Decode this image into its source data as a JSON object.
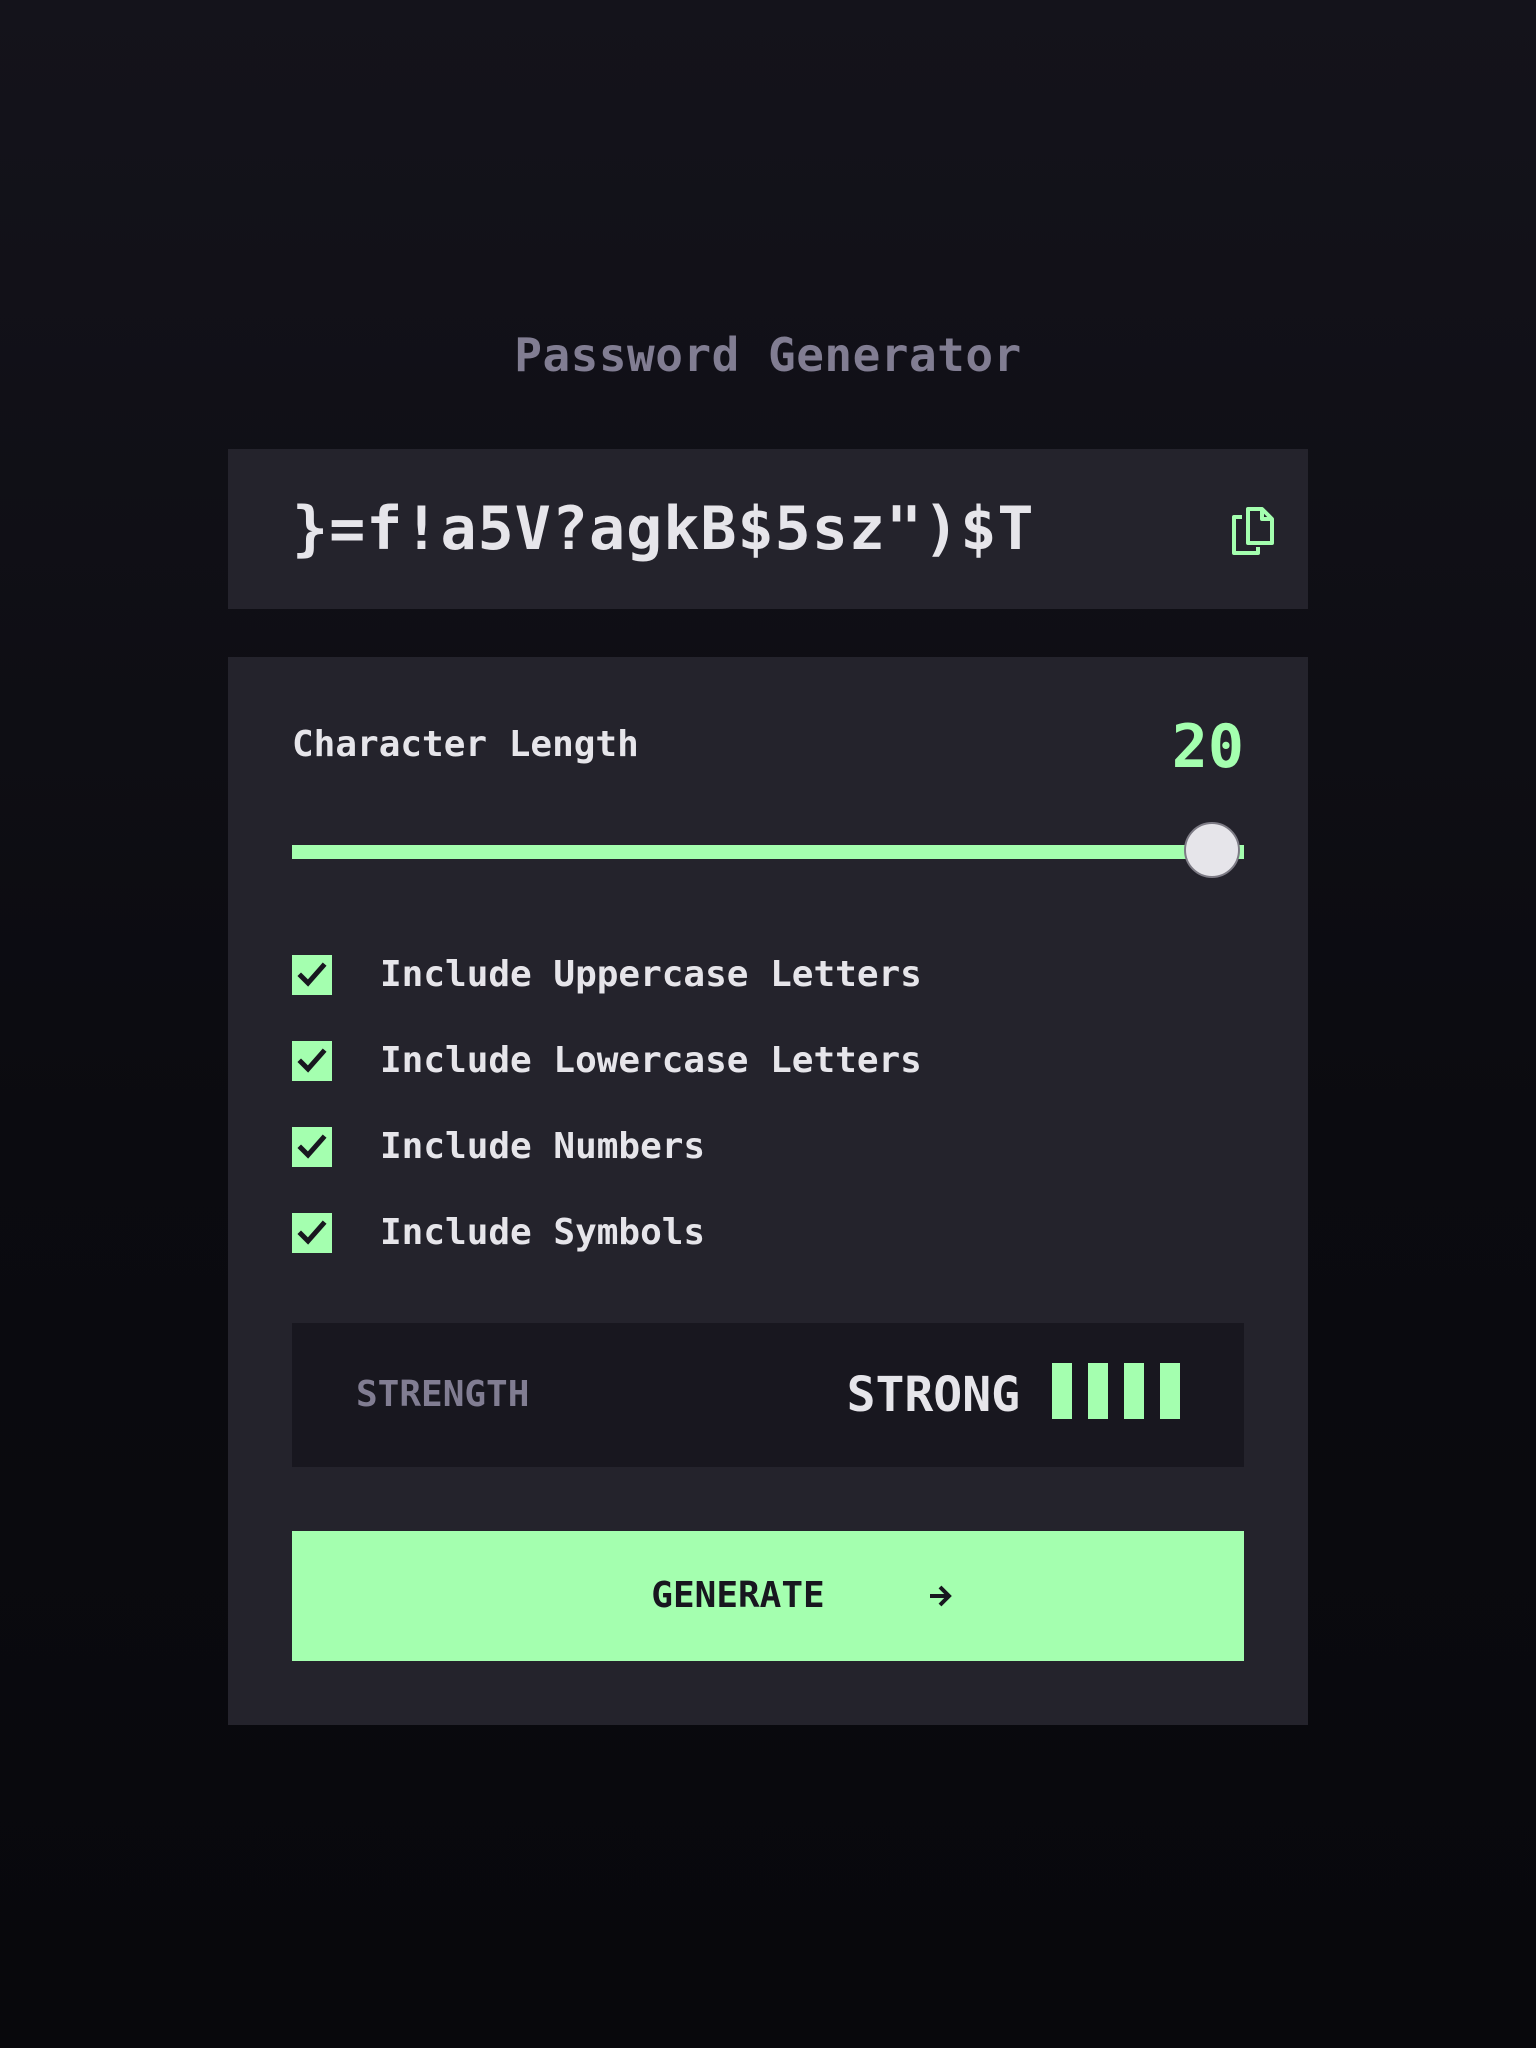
{
  "header": {
    "title": "Password Generator"
  },
  "output": {
    "password": "}=f!a5V?agkB$5sz\")$T",
    "copy_icon": "copy-icon"
  },
  "length": {
    "label": "Character Length",
    "value": "20",
    "slider_fraction": 1.0
  },
  "options": [
    {
      "label": "Include Uppercase Letters",
      "checked": true
    },
    {
      "label": "Include Lowercase Letters",
      "checked": true
    },
    {
      "label": "Include Numbers",
      "checked": true
    },
    {
      "label": "Include Symbols",
      "checked": true
    }
  ],
  "strength": {
    "label": "STRENGTH",
    "value": "STRONG",
    "bars_filled": 4,
    "bars_total": 4
  },
  "generate": {
    "label": "GENERATE",
    "icon": "arrow-right-icon"
  },
  "colors": {
    "accent": "#a4ffaf",
    "panel": "#24232c",
    "inset": "#18171f",
    "muted_text": "#817d92",
    "text": "#e6e5ea"
  }
}
